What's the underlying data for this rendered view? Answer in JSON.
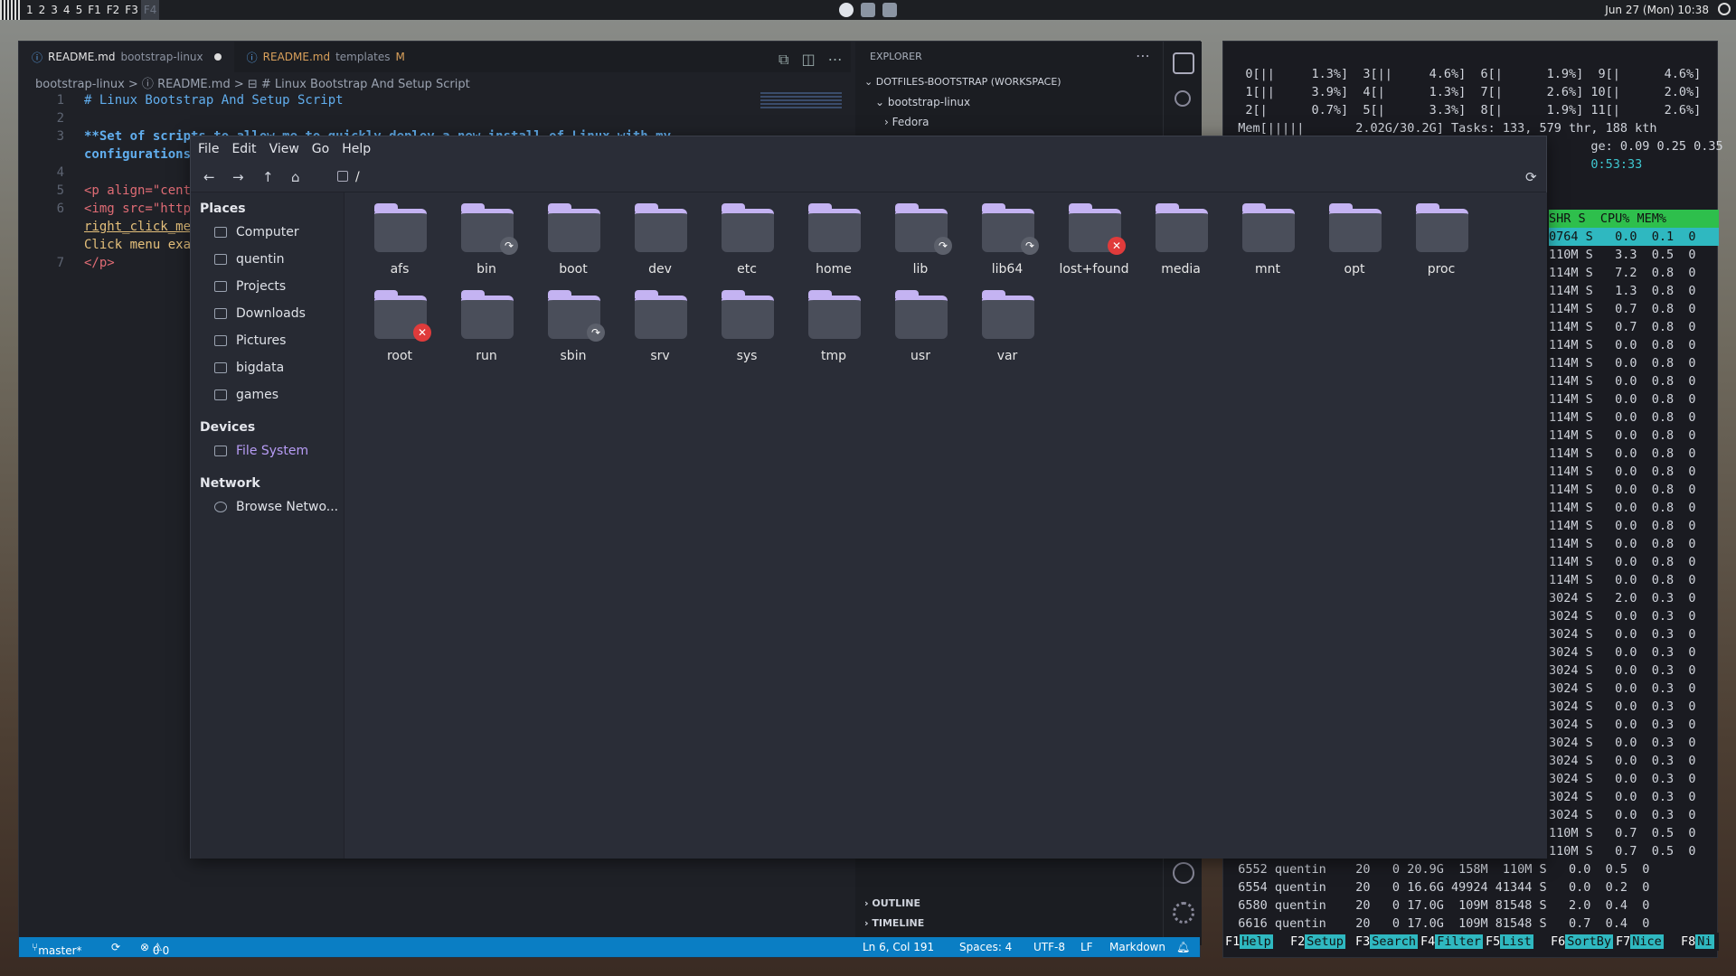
{
  "topbar": {
    "workspaces": [
      "1",
      "2",
      "3",
      "4",
      "5",
      "F1",
      "F2",
      "F3",
      "F4"
    ],
    "clock": "Jun 27 (Mon) 10:38"
  },
  "vscode": {
    "tabs": [
      {
        "file": "README.md",
        "sub": "bootstrap-linux"
      },
      {
        "file": "README.md",
        "sub": "templates",
        "mod": "M"
      }
    ],
    "breadcrumb": "bootstrap-linux > ⓘ README.md > ⊟ # Linux Bootstrap And Setup Script",
    "lines": [
      {
        "n": "1",
        "t": "# Linux Bootstrap And Setup Script"
      },
      {
        "n": "2",
        "t": ""
      },
      {
        "n": "3",
        "t": "**Set of scripts to allow me to quickly deploy a new install of Linux with my"
      },
      {
        "n": "",
        "t": "configurations"
      },
      {
        "n": "4",
        "t": ""
      },
      {
        "n": "5",
        "t": "<p align=\"cent"
      },
      {
        "n": "6",
        "t": "<img src=\"http"
      },
      {
        "n": "",
        "t": "right_click_me"
      },
      {
        "n": "",
        "t": "Click menu exa"
      },
      {
        "n": "7",
        "t": "</p>"
      }
    ],
    "explorer": {
      "title": "EXPLORER",
      "workspace": "DOTFILES-BOOTSTRAP (WORKSPACE)",
      "folder": "bootstrap-linux",
      "sub": "Fedora",
      "outline": "OUTLINE",
      "timeline": "TIMELINE"
    },
    "status": {
      "branch": "master*",
      "errors": "0",
      "warnings": "0",
      "pos": "Ln 6, Col 191",
      "spaces": "Spaces: 4",
      "enc": "UTF-8",
      "eol": "LF",
      "lang": "Markdown"
    }
  },
  "filemanager": {
    "menu": [
      "File",
      "Edit",
      "View",
      "Go",
      "Help"
    ],
    "path": "/",
    "places_header": "Places",
    "places": [
      "Computer",
      "quentin",
      "Projects",
      "Downloads",
      "Pictures",
      "bigdata",
      "games"
    ],
    "devices_header": "Devices",
    "devices": [
      "File System"
    ],
    "network_header": "Network",
    "network": [
      "Browse Netwo..."
    ],
    "folders": [
      {
        "name": "afs",
        "badge": ""
      },
      {
        "name": "bin",
        "badge": "link"
      },
      {
        "name": "boot",
        "badge": ""
      },
      {
        "name": "dev",
        "badge": ""
      },
      {
        "name": "etc",
        "badge": ""
      },
      {
        "name": "home",
        "badge": ""
      },
      {
        "name": "lib",
        "badge": "link"
      },
      {
        "name": "lib64",
        "badge": "link"
      },
      {
        "name": "lost+found",
        "badge": "x"
      },
      {
        "name": "media",
        "badge": ""
      },
      {
        "name": "mnt",
        "badge": ""
      },
      {
        "name": "opt",
        "badge": ""
      },
      {
        "name": "proc",
        "badge": ""
      },
      {
        "name": "root",
        "badge": "x"
      },
      {
        "name": "run",
        "badge": ""
      },
      {
        "name": "sbin",
        "badge": "link"
      },
      {
        "name": "srv",
        "badge": ""
      },
      {
        "name": "sys",
        "badge": ""
      },
      {
        "name": "tmp",
        "badge": ""
      },
      {
        "name": "usr",
        "badge": ""
      },
      {
        "name": "var",
        "badge": ""
      }
    ]
  },
  "htop": {
    "cpu": [
      "   0[||     1.3%]  3[||     4.6%]  6[|      1.9%]  9[|      4.6%]",
      "   1[||     3.9%]  4[|      1.3%]  7[|      2.6%] 10[|      2.0%]",
      "   2[|      0.7%]  5[|      3.3%]  8[|      1.9%] 11[|      2.6%]"
    ],
    "mem": "  Mem[|||||       2.02G/30.2G] Tasks: 133, 579 thr, 188 kth",
    "load": "                                                  ge: 0.09 0.25 0.35",
    "uptime": "                                                  0:53:33",
    "header": "SHR S  CPU% MEM%",
    "rows": [
      "0764 S   0.0  0.1  0",
      "110M S   3.3  0.5  0",
      "114M S   7.2  0.8  0",
      "114M S   1.3  0.8  0",
      "114M S   0.7  0.8  0",
      "114M S   0.7  0.8  0",
      "114M S   0.0  0.8  0",
      "114M S   0.0  0.8  0",
      "114M S   0.0  0.8  0",
      "114M S   0.0  0.8  0",
      "114M S   0.0  0.8  0",
      "114M S   0.0  0.8  0",
      "114M S   0.0  0.8  0",
      "114M S   0.0  0.8  0",
      "114M S   0.0  0.8  0",
      "114M S   0.0  0.8  0",
      "114M S   0.0  0.8  0",
      "114M S   0.0  0.8  0",
      "114M S   0.0  0.8  0",
      "114M S   0.0  0.8  0",
      "3024 S   2.0  0.3  0",
      "3024 S   0.0  0.3  0",
      "3024 S   0.0  0.3  0",
      "3024 S   0.0  0.3  0",
      "3024 S   0.0  0.3  0",
      "3024 S   0.0  0.3  0",
      "3024 S   0.0  0.3  0",
      "3024 S   0.0  0.3  0",
      "3024 S   0.0  0.3  0",
      "3024 S   0.0  0.3  0",
      "3024 S   0.0  0.3  0",
      "3024 S   0.0  0.3  0",
      "3024 S   0.0  0.3  0",
      "110M S   0.7  0.5  0",
      "110M S   0.7  0.5  0"
    ],
    "procs": [
      "  6552 quentin    20   0 20.9G  158M  110M S   0.0  0.5  0",
      "  6554 quentin    20   0 16.6G 49924 41344 S   0.0  0.2  0",
      "  6580 quentin    20   0 17.0G  109M 81548 S   2.0  0.4  0",
      "  6616 quentin    20   0 17.0G  109M 81548 S   0.7  0.4  0"
    ],
    "fkeys": [
      [
        "F1",
        "Help"
      ],
      [
        "F2",
        "Setup"
      ],
      [
        "F3",
        "Search"
      ],
      [
        "F4",
        "Filter"
      ],
      [
        "F5",
        "List"
      ],
      [
        "F6",
        "SortBy"
      ],
      [
        "F7",
        "Nice"
      ],
      [
        "F8",
        "Ni"
      ]
    ]
  }
}
